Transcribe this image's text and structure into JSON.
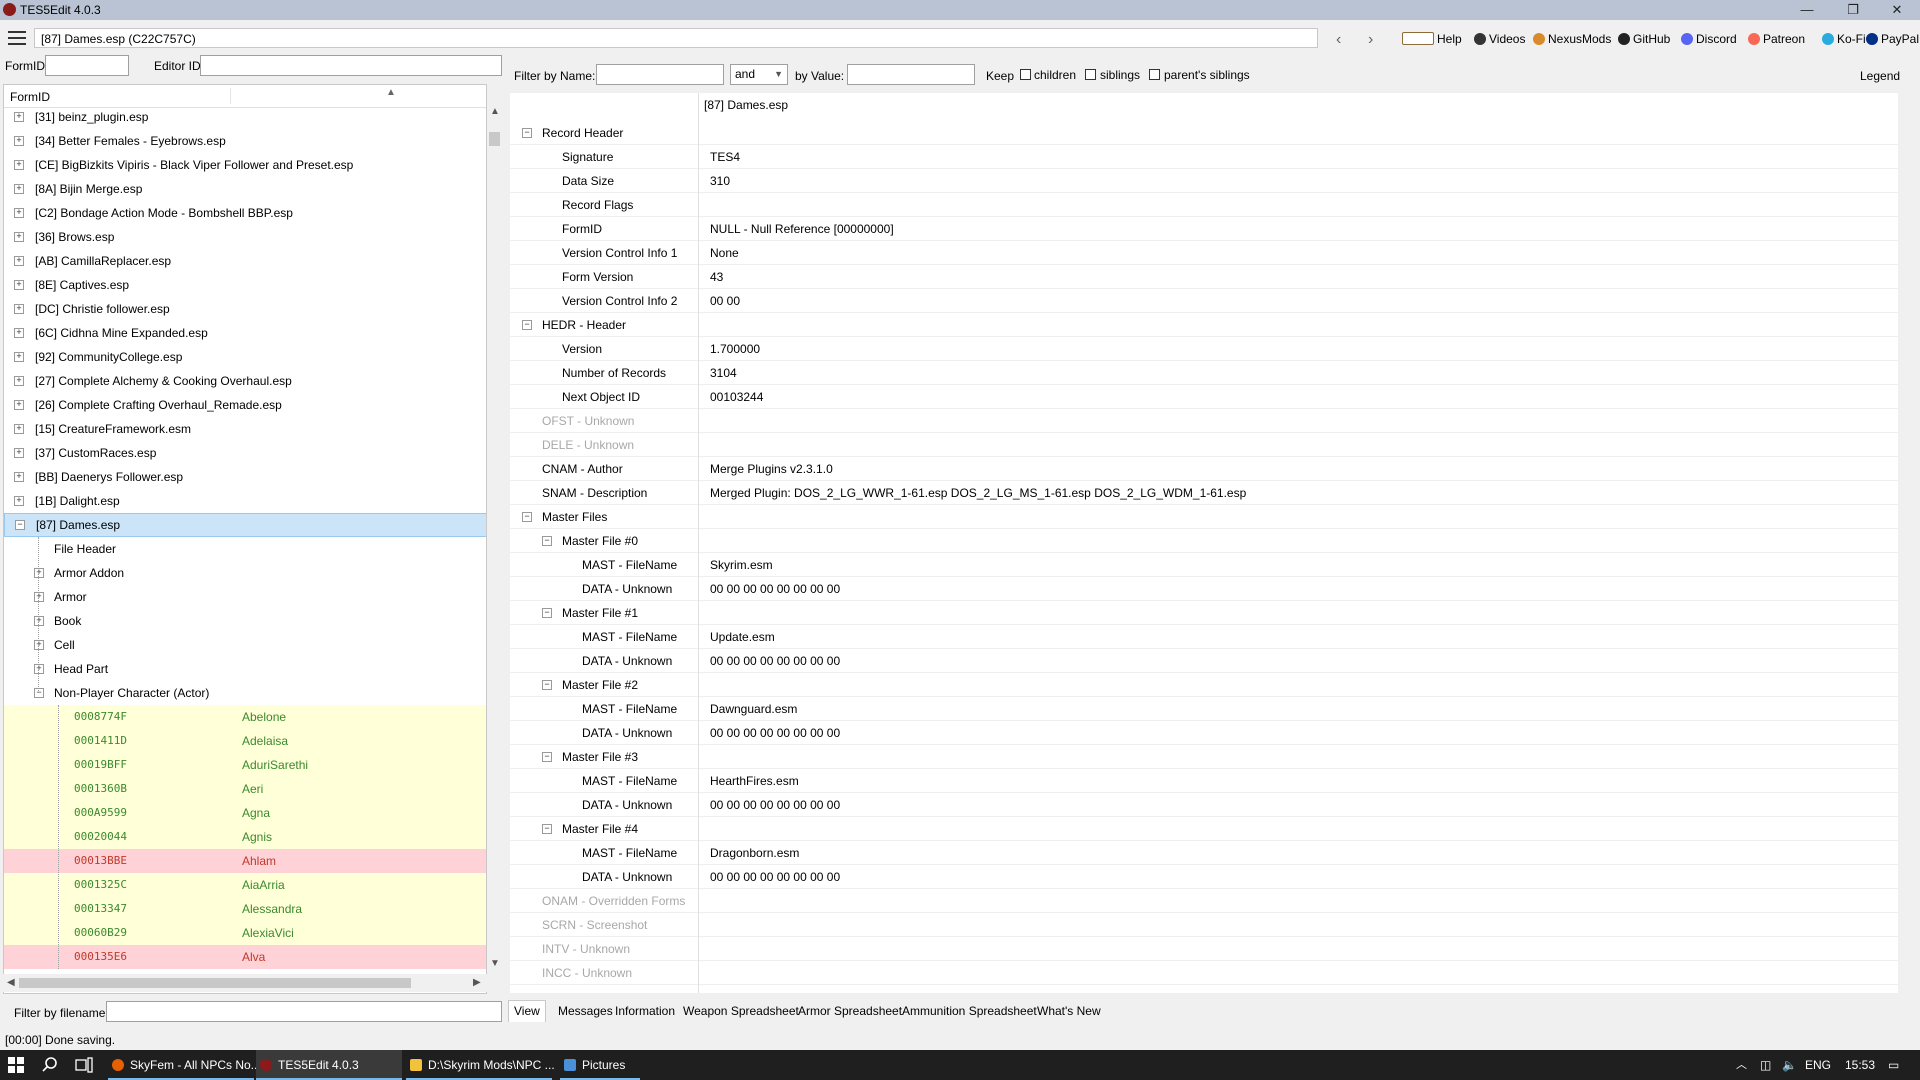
{
  "window": {
    "title": "TES5Edit 4.0.3",
    "minimize": "—",
    "restore": "❐",
    "close": "✕"
  },
  "pathbar": {
    "path": "[87] Dames.esp (C22C757C)",
    "back": "‹",
    "forward": "›",
    "links": [
      {
        "label": "Help",
        "color": "#8a6d3b"
      },
      {
        "label": "Videos",
        "color": "#333333"
      },
      {
        "label": "NexusMods",
        "color": "#d98b2b"
      },
      {
        "label": "GitHub",
        "color": "#222222"
      },
      {
        "label": "Discord",
        "color": "#5865f2"
      },
      {
        "label": "Patreon",
        "color": "#f96854"
      },
      {
        "label": "Ko-Fi",
        "color": "#29abe0"
      },
      {
        "label": "PayPal",
        "color": "#003087"
      }
    ]
  },
  "left": {
    "formid_label": "FormID",
    "editorid_label": "Editor ID",
    "tree_header": "FormID",
    "files": [
      "[31] beinz_plugin.esp",
      "[34] Better Females - Eyebrows.esp",
      "[CE] BigBizkits Vipiris - Black Viper Follower and Preset.esp",
      "[8A] Bijin Merge.esp",
      "[C2] Bondage Action Mode - Bombshell BBP.esp",
      "[36] Brows.esp",
      "[AB] CamillaReplacer.esp",
      "[8E] Captives.esp",
      "[DC] Christie follower.esp",
      "[6C] Cidhna Mine Expanded.esp",
      "[92] CommunityCollege.esp",
      "[27] Complete Alchemy & Cooking Overhaul.esp",
      "[26] Complete Crafting Overhaul_Remade.esp",
      "[15] CreatureFramework.esm",
      "[37] CustomRaces.esp",
      "[BB] Daenerys Follower.esp",
      "[1B] Dalight.esp"
    ],
    "selected": "[87] Dames.esp",
    "children": [
      "File Header",
      "Armor Addon",
      "Armor",
      "Book",
      "Cell",
      "Head Part",
      "Non-Player Character (Actor)"
    ],
    "npcs": [
      {
        "fid": "0008774F",
        "ed": "Abelone",
        "bg": "yellow"
      },
      {
        "fid": "0001411D",
        "ed": "Adelaisa",
        "bg": "yellow"
      },
      {
        "fid": "00019BFF",
        "ed": "AduriSarethi",
        "bg": "yellow"
      },
      {
        "fid": "0001360B",
        "ed": "Aeri",
        "bg": "yellow"
      },
      {
        "fid": "000A9599",
        "ed": "Agna",
        "bg": "yellow"
      },
      {
        "fid": "00020044",
        "ed": "Agnis",
        "bg": "yellow"
      },
      {
        "fid": "00013BBE",
        "ed": "Ahlam",
        "bg": "red"
      },
      {
        "fid": "0001325C",
        "ed": "AiaArria",
        "bg": "yellow"
      },
      {
        "fid": "00013347",
        "ed": "Alessandra",
        "bg": "yellow"
      },
      {
        "fid": "00060B29",
        "ed": "AlexiaVici",
        "bg": "yellow"
      },
      {
        "fid": "000135E6",
        "ed": "Alva",
        "bg": "red"
      }
    ],
    "filter_label": "Filter by filename:"
  },
  "filter": {
    "by_name": "Filter by Name:",
    "op": "and",
    "by_value": "by Value:",
    "keep": "Keep",
    "children": "children",
    "siblings": "siblings",
    "parents_siblings": "parent's siblings",
    "legend": "Legend"
  },
  "detail": {
    "header": "[87] Dames.esp",
    "rows": [
      {
        "k": "Record Header",
        "v": "",
        "lvl": 0,
        "exp": "−"
      },
      {
        "k": "Signature",
        "v": "TES4",
        "lvl": 1
      },
      {
        "k": "Data Size",
        "v": "310",
        "lvl": 1
      },
      {
        "k": "Record Flags",
        "v": "",
        "lvl": 1
      },
      {
        "k": "FormID",
        "v": "NULL - Null Reference [00000000]",
        "lvl": 1
      },
      {
        "k": "Version Control Info 1",
        "v": "None",
        "lvl": 1
      },
      {
        "k": "Form Version",
        "v": "43",
        "lvl": 1
      },
      {
        "k": "Version Control Info 2",
        "v": "00 00",
        "lvl": 1
      },
      {
        "k": "HEDR - Header",
        "v": "",
        "lvl": 0,
        "exp": "−"
      },
      {
        "k": "Version",
        "v": "1.700000",
        "lvl": 1
      },
      {
        "k": "Number of Records",
        "v": "3104",
        "lvl": 1
      },
      {
        "k": "Next Object ID",
        "v": "00103244",
        "lvl": 1
      },
      {
        "k": "OFST - Unknown",
        "v": "",
        "lvl": 0,
        "gray": true
      },
      {
        "k": "DELE - Unknown",
        "v": "",
        "lvl": 0,
        "gray": true
      },
      {
        "k": "CNAM - Author",
        "v": "Merge Plugins v2.3.1.0",
        "lvl": 0
      },
      {
        "k": "SNAM - Description",
        "v": "Merged Plugin:  DOS_2_LG_WWR_1-61.esp  DOS_2_LG_MS_1-61.esp  DOS_2_LG_WDM_1-61.esp",
        "lvl": 0
      },
      {
        "k": "Master Files",
        "v": "",
        "lvl": 0,
        "exp": "−"
      },
      {
        "k": "Master File #0",
        "v": "",
        "lvl": 1,
        "exp": "−"
      },
      {
        "k": "MAST - FileName",
        "v": "Skyrim.esm",
        "lvl": 2
      },
      {
        "k": "DATA - Unknown",
        "v": "00 00 00 00 00 00 00 00",
        "lvl": 2
      },
      {
        "k": "Master File #1",
        "v": "",
        "lvl": 1,
        "exp": "−"
      },
      {
        "k": "MAST - FileName",
        "v": "Update.esm",
        "lvl": 2
      },
      {
        "k": "DATA - Unknown",
        "v": "00 00 00 00 00 00 00 00",
        "lvl": 2
      },
      {
        "k": "Master File #2",
        "v": "",
        "lvl": 1,
        "exp": "−"
      },
      {
        "k": "MAST - FileName",
        "v": "Dawnguard.esm",
        "lvl": 2
      },
      {
        "k": "DATA - Unknown",
        "v": "00 00 00 00 00 00 00 00",
        "lvl": 2
      },
      {
        "k": "Master File #3",
        "v": "",
        "lvl": 1,
        "exp": "−"
      },
      {
        "k": "MAST - FileName",
        "v": "HearthFires.esm",
        "lvl": 2
      },
      {
        "k": "DATA - Unknown",
        "v": "00 00 00 00 00 00 00 00",
        "lvl": 2
      },
      {
        "k": "Master File #4",
        "v": "",
        "lvl": 1,
        "exp": "−"
      },
      {
        "k": "MAST - FileName",
        "v": "Dragonborn.esm",
        "lvl": 2
      },
      {
        "k": "DATA - Unknown",
        "v": "00 00 00 00 00 00 00 00",
        "lvl": 2
      },
      {
        "k": "ONAM - Overridden Forms",
        "v": "",
        "lvl": 0,
        "gray": true
      },
      {
        "k": "SCRN - Screenshot",
        "v": "",
        "lvl": 0,
        "gray": true
      },
      {
        "k": "INTV - Unknown",
        "v": "",
        "lvl": 0,
        "gray": true
      },
      {
        "k": "INCC - Unknown",
        "v": "",
        "lvl": 0,
        "gray": true
      }
    ]
  },
  "tabs": [
    "View",
    "Messages",
    "Information",
    "Weapon Spreadsheet",
    "Armor Spreadsheet",
    "Ammunition Spreadsheet",
    "What's New"
  ],
  "status": "[00:00] Done saving.",
  "taskbar": {
    "items": [
      {
        "label": "SkyFem - All NPCs No...",
        "color": "#e66000"
      },
      {
        "label": "TES5Edit 4.0.3",
        "color": "#8b1a1a"
      },
      {
        "label": "D:\\Skyrim Mods\\NPC ...",
        "color": "#f3c23c"
      },
      {
        "label": "Pictures",
        "color": "#4a90d9"
      }
    ],
    "lang": "ENG",
    "time": "15:53"
  }
}
